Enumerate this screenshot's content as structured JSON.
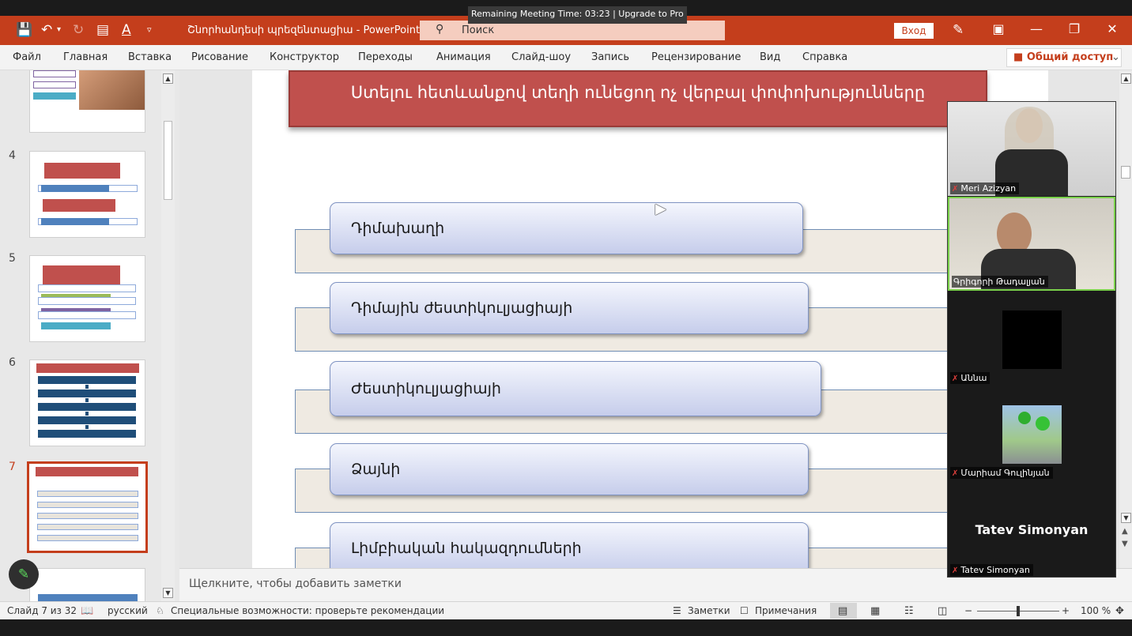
{
  "meeting": {
    "timer": "Remaining Meeting Time: 03:23 | Upgrade to Pro"
  },
  "window": {
    "doc_title": "Շնորհանդեսի պրեզենտացիա  -  PowerPoint",
    "search_placeholder": "Поиск",
    "login": "Вход"
  },
  "ribbon": {
    "tabs": [
      "Файл",
      "Главная",
      "Вставка",
      "Рисование",
      "Конструктор",
      "Переходы",
      "Анимация",
      "Слайд-шоу",
      "Запись",
      "Рецензирование",
      "Вид",
      "Справка"
    ],
    "share": "Общий доступ"
  },
  "thumbnails": {
    "numbers": [
      "4",
      "5",
      "6",
      "7"
    ],
    "selected": "7"
  },
  "slide": {
    "title": "Ստելու հետևանքով տեղի ունեցող ոչ վերբալ փոփոխությունները",
    "items": [
      "Դիմախաղի",
      "Դիմային ժեստիկուլյացիայի",
      "Ժեստիկուլյացիայի",
      "Ձայնի",
      "Լիմբիական հակազդումների"
    ]
  },
  "notes": {
    "placeholder": "Щелкните, чтобы добавить заметки"
  },
  "status": {
    "slide_counter": "Слайд 7 из 32",
    "language": "русский",
    "accessibility": "Специальные возможности: проверьте рекомендации",
    "notes_btn": "Заметки",
    "comments_btn": "Примечания",
    "zoom": "100 %"
  },
  "participants": [
    {
      "name": "Meri Azizyan",
      "muted": true
    },
    {
      "name": "Գրիգորի Թադալյան",
      "muted": false,
      "active": true
    },
    {
      "name": "Աննա",
      "muted": true
    },
    {
      "name": "Մարիամ Գուլինյան",
      "muted": true
    },
    {
      "name": "Tatev Simonyan",
      "muted": true,
      "display_text": "Tatev Simonyan"
    }
  ],
  "colors": {
    "accent": "#c43e1c",
    "slide_title_bg": "#c0504d",
    "active_speaker": "#7ad04b"
  }
}
